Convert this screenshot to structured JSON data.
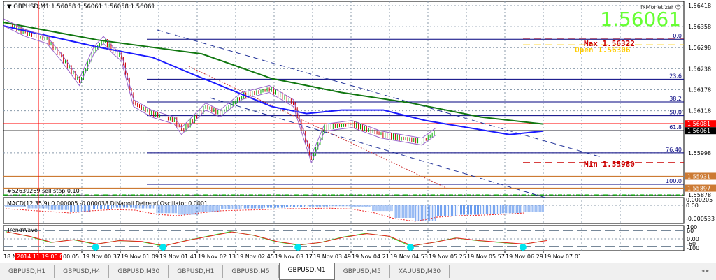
{
  "header": {
    "symbol": "GBPUSD,M1",
    "ohlc": "1.56058 1.56061 1.56058 1.56061"
  },
  "widget": {
    "brand": "fxMonetizer",
    "price": "1.56061"
  },
  "price_axis": [
    "1.56418",
    "1.56358",
    "1.56298",
    "1.56238",
    "1.56178",
    "1.56118",
    "1.55998",
    "1.55878"
  ],
  "price_tags": {
    "red": "1.56081",
    "current": "1.56061",
    "orange1": "1.55931",
    "orange2": "1.55897"
  },
  "fib": [
    {
      "label": "0.0",
      "price": 1.56322
    },
    {
      "label": "23.6",
      "price": 1.56208
    },
    {
      "label": "38.2",
      "price": 1.56143
    },
    {
      "label": "50.0",
      "price": 1.56104
    },
    {
      "label": "61.8",
      "price": 1.56061
    },
    {
      "label": "76.40",
      "price": 1.55998
    },
    {
      "label": "100.0",
      "price": 1.55908
    }
  ],
  "annotations": {
    "max": "Max 1.56322",
    "open": "Open 1.56306",
    "min": "Min 1.55980",
    "order": "#52639269 sell stop 0.10"
  },
  "macd": {
    "label": "MACD(12,35,9) 0.000005 -0.000038  DiNapoli Detrend Oscillator 0.0001",
    "axis_top": "0.000205",
    "axis_zero": "0.00",
    "axis_bottom": "-0.000533"
  },
  "trendwave": {
    "label": "TrendWave",
    "axis": [
      "100",
      "60",
      "0.00",
      "-60",
      "-100"
    ]
  },
  "time_axis": {
    "start": "18 N",
    "cursor": "2014.11.19 00:01",
    "first": "00:05",
    "labels": [
      "19 Nov 00:37",
      "19 Nov 01:09",
      "19 Nov 01:41",
      "19 Nov 02:13",
      "19 Nov 02:45",
      "19 Nov 03:17",
      "19 Nov 03:49",
      "19 Nov 04:21",
      "19 Nov 04:53",
      "19 Nov 05:25",
      "19 Nov 05:57",
      "19 Nov 06:29",
      "19 Nov 07:01"
    ]
  },
  "tabs": [
    "GBPUSD,H1",
    "GBPUSD,H4",
    "GBPUSD,M30",
    "GBPUSD,H1",
    "GBPUSD,M5",
    "GBPUSD,M1",
    "GBPUSD,M5",
    "XAUUSD,M30"
  ],
  "active_tab": 5,
  "colors": {
    "bull": "#00aa00",
    "bear": "#cc0000",
    "ma_fast": "#1a1aff",
    "ma_slow": "#117711",
    "fib": "#00007f",
    "accent_green": "#66ff33",
    "orange": "#cc7a33"
  },
  "chart_data": {
    "type": "line",
    "x_unit": "minutes since 19 Nov 00:00",
    "price": [
      [
        -28,
        1.5637
      ],
      [
        -10,
        1.5634
      ],
      [
        8,
        1.5632
      ],
      [
        20,
        1.5627
      ],
      [
        35,
        1.562
      ],
      [
        47,
        1.5629
      ],
      [
        55,
        1.5632
      ],
      [
        63,
        1.5629
      ],
      [
        70,
        1.5627
      ],
      [
        80,
        1.5614
      ],
      [
        95,
        1.5611
      ],
      [
        114,
        1.5609
      ],
      [
        120,
        1.5606
      ],
      [
        140,
        1.5613
      ],
      [
        152,
        1.5611
      ],
      [
        170,
        1.5616
      ],
      [
        193,
        1.5618
      ],
      [
        213,
        1.5614
      ],
      [
        228,
        1.5598
      ],
      [
        239,
        1.5607
      ],
      [
        262,
        1.5608
      ],
      [
        286,
        1.5605
      ],
      [
        303,
        1.5604
      ],
      [
        320,
        1.5603
      ],
      [
        332,
        1.5606
      ]
    ],
    "ma_fast": [
      [
        -28,
        1.5636
      ],
      [
        50,
        1.563
      ],
      [
        96,
        1.5627
      ],
      [
        131,
        1.5622
      ],
      [
        195,
        1.5613
      ],
      [
        224,
        1.5611
      ],
      [
        253,
        1.5612
      ],
      [
        288,
        1.5612
      ],
      [
        323,
        1.5609
      ],
      [
        358,
        1.5607
      ],
      [
        393,
        1.5605
      ],
      [
        421,
        1.5606
      ]
    ],
    "ma_slow": [
      [
        -28,
        1.5637
      ],
      [
        50,
        1.5632
      ],
      [
        137,
        1.5628
      ],
      [
        195,
        1.5621
      ],
      [
        253,
        1.5617
      ],
      [
        311,
        1.5614
      ],
      [
        369,
        1.561
      ],
      [
        421,
        1.5608
      ]
    ],
    "macd_hist": [
      -5e-05,
      -0.0001,
      -0.00015,
      -0.0002,
      -0.00012,
      -8e-05,
      -0.0001,
      -0.00025,
      -0.0003,
      -0.0002,
      -0.00012,
      -0.0001,
      -8e-05,
      -5e-05,
      -4e-05,
      -3e-05,
      -6e-05,
      -0.00018,
      -0.0004,
      -0.0005,
      -0.00035,
      -0.0003,
      -0.00028,
      -0.00025,
      -0.0002
    ],
    "trendwave": [
      80,
      30,
      -40,
      -10,
      -60,
      -20,
      -30,
      -80,
      -20,
      30,
      80,
      40,
      -30,
      -70,
      -40,
      20,
      60,
      30,
      -80,
      -40,
      10,
      -20,
      -40,
      -60,
      -20
    ]
  }
}
